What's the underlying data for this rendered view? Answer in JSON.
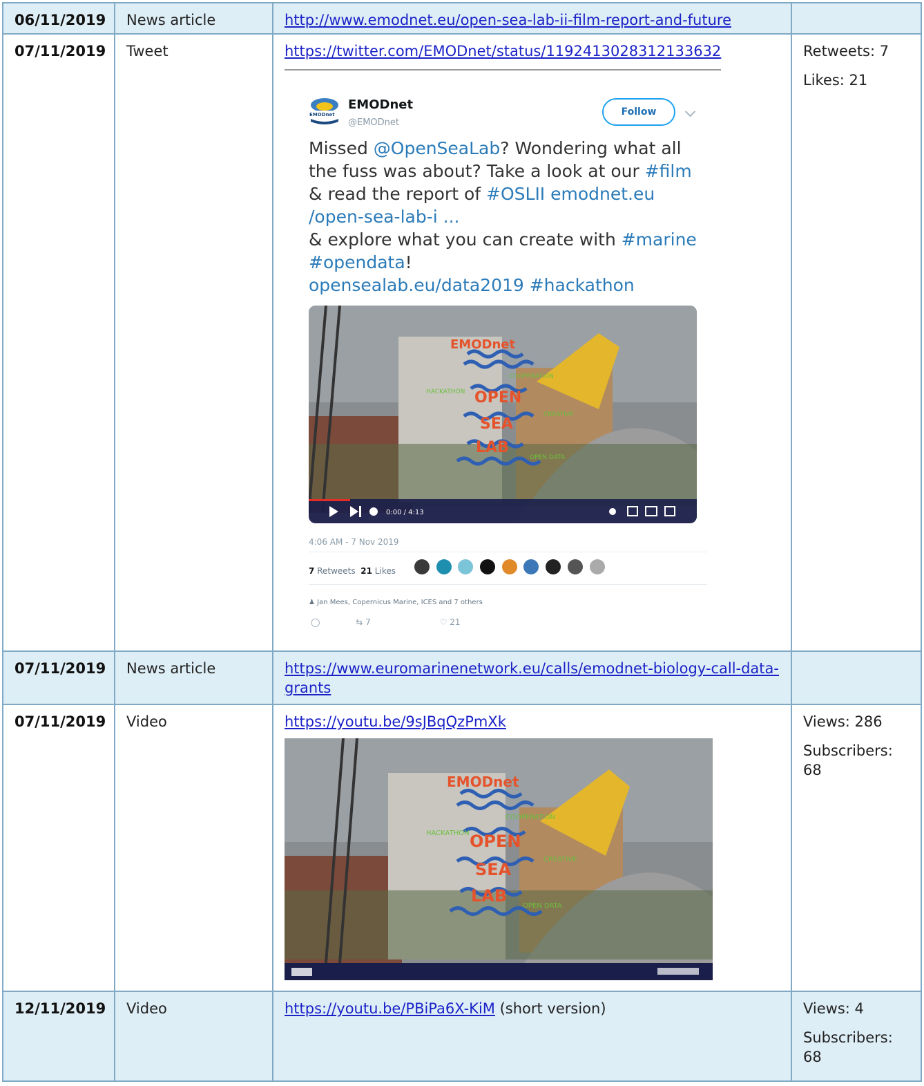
{
  "rows": [
    {
      "date": "06/11/2019",
      "type": "News article",
      "link": "http://www.emodnet.eu/open-sea-lab-ii-film-report-and-future"
    },
    {
      "date": "07/11/2019",
      "type": "Tweet",
      "link": "https://twitter.com/EMODnet/status/1192413028312133632",
      "metric1": "Retweets: 7",
      "metric2": "Likes: 21"
    },
    {
      "date": "07/11/2019",
      "type": "News article",
      "link": "https://www.euromarinenetwork.eu/calls/emodnet-biology-call-data-grants"
    },
    {
      "date": "07/11/2019",
      "type": "Video",
      "link": "https://youtu.be/9sJBqQzPmXk",
      "metric1": "Views: 286",
      "metric2": "Subscribers: 68"
    },
    {
      "date": "12/11/2019",
      "type": "Video",
      "link": "https://youtu.be/PBiPa6X-KiM",
      "link_suffix": " (short version)",
      "metric1": "Views: 4",
      "metric2": "Subscribers: 68"
    }
  ],
  "tweet": {
    "name": "EMODnet",
    "handle": "@EMODnet",
    "logo_text": "EMODnet",
    "follow": "Follow",
    "text_1": "Missed ",
    "mention": "@OpenSeaLab",
    "text_2": "? Wondering what all the fuss was about? Take a look at our ",
    "tag_film": "#film",
    "text_3": " & read the report of ",
    "tag_osl": "#OSLII",
    "link_1": " emodnet.eu /open-sea-lab-i ...",
    "text_4": "& explore what you can create with ",
    "tag_marine": "#marine",
    "tag_opendata": "#opendata",
    "text_5": "!",
    "link_2": "opensealab.eu/data2019",
    "tag_hackathon": " #hackathon",
    "time": "4:06 AM - 7 Nov 2019",
    "retweets_count": "7",
    "retweets_label": "Retweets",
    "likes_count": "21",
    "likes_label": "Likes",
    "liked_by": "Jan Mees, Copernicus Marine, ICES and 7 others",
    "reply_icon": "reply-icon",
    "retweet_action": "7",
    "like_action": "21"
  },
  "video_overlay": {
    "brand": "EMODnet",
    "open": "OPEN",
    "sea": "SEA",
    "lab": "LAB",
    "w1": "COOPERATION",
    "w2": "HACKATHON",
    "w3": "CREATIVE",
    "w4": "OPEN DATA",
    "timecode": "0:00 / 4:13"
  },
  "colors": {
    "border": "#7fa9c4",
    "row_alt": "#deeef6",
    "link": "#1a22c8",
    "twitter_blue": "#2b7bb9"
  }
}
